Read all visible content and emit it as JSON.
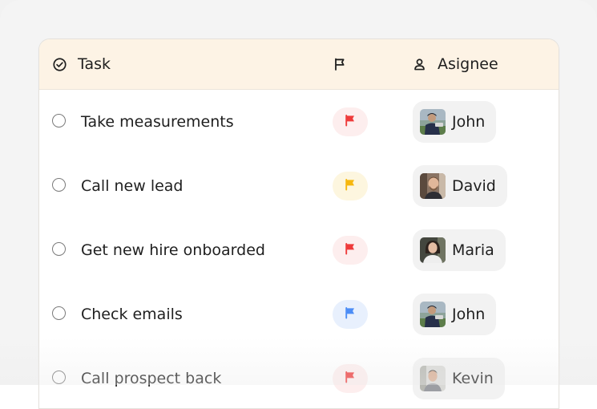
{
  "header": {
    "task_label": "Task",
    "assignee_label": "Asignee",
    "task_icon": "check-circle-icon",
    "flag_icon": "flag-icon",
    "assignee_icon": "user-icon"
  },
  "colors": {
    "header_bg": "#fdf3e5",
    "flag_red": "#ee3b3b",
    "flag_red_bg": "#fdeeee",
    "flag_yellow": "#f6b70f",
    "flag_yellow_bg": "#fdf6df",
    "flag_blue": "#4c8df6",
    "flag_blue_bg": "#e8f0fd"
  },
  "rows": [
    {
      "task": "Take measurements",
      "priority": "red",
      "assignee": "John"
    },
    {
      "task": "Call new lead",
      "priority": "yellow",
      "assignee": "David"
    },
    {
      "task": "Get new hire onboarded",
      "priority": "red",
      "assignee": "Maria"
    },
    {
      "task": "Check emails",
      "priority": "blue",
      "assignee": "John"
    },
    {
      "task": "Call prospect back",
      "priority": "red",
      "assignee": "Kevin"
    }
  ]
}
